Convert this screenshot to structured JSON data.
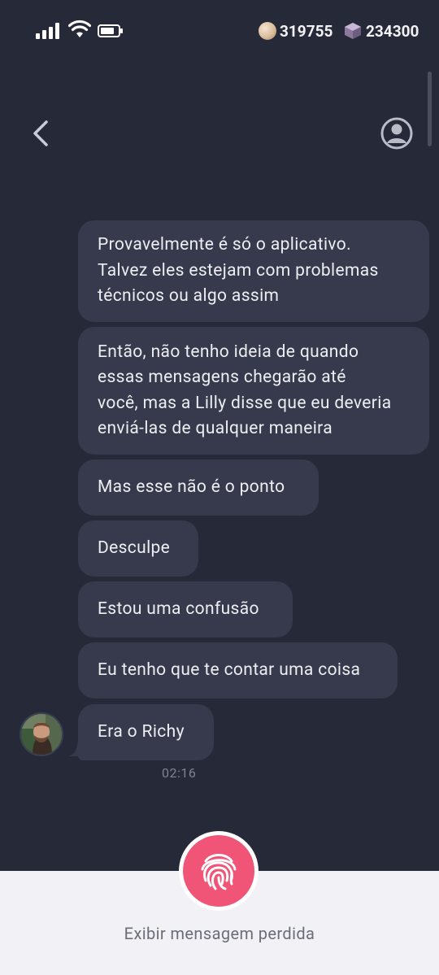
{
  "status_bar": {
    "coins": "319755",
    "gems": "234300",
    "icons": [
      "signal-icon",
      "wifi-icon",
      "battery-icon",
      "coin-icon",
      "gem-icon"
    ]
  },
  "header": {
    "back_icon": "chevron-left-icon",
    "profile_icon": "user-circle-icon"
  },
  "messages": [
    {
      "text": "Provavelmente é só o aplicativo.\nTalvez eles estejam com problemas\ntécnicos ou algo assim"
    },
    {
      "text": "Então, não tenho ideia de quando\nessas mensagens chegarão até\nvocê, mas a Lilly disse que eu deveria\nenviá-las de qualquer maneira"
    },
    {
      "text": "Mas esse não é o ponto"
    },
    {
      "text": "Desculpe"
    },
    {
      "text": "Estou uma confusão"
    },
    {
      "text": "Eu tenho que te contar uma coisa"
    },
    {
      "text": "Era o Richy"
    }
  ],
  "timestamp": "02:16",
  "bottom": {
    "action_icon": "fingerprint-icon",
    "label": "Exibir mensagem perdida"
  },
  "colors": {
    "background": "#262937",
    "bubble": "#373a4c",
    "bottom_panel": "#f1f1f6",
    "accent": "#f05577"
  }
}
